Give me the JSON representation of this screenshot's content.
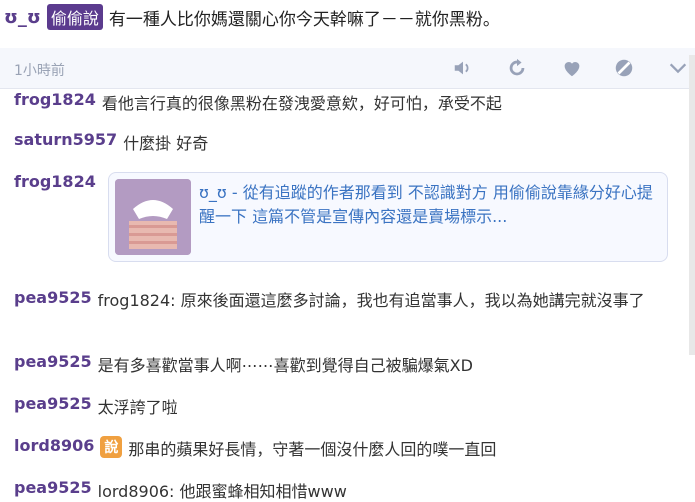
{
  "post": {
    "author": "ʊ_ʊ",
    "board": "偷偷說",
    "text": "有一種人比你媽還關心你今天幹嘛了－－就你黑粉。"
  },
  "meta": {
    "time": "1小時前",
    "icons": [
      "speaker-icon",
      "refresh-icon",
      "heart-icon",
      "block-icon",
      "chevron-down-icon"
    ]
  },
  "comments": [
    {
      "user": "frog1824",
      "text": "看他言行真的很像黑粉在發洩愛意欸，好可怕，承受不起"
    },
    {
      "user": "saturn5957",
      "text": "什麼掛 好奇"
    },
    {
      "user": "frog1824",
      "text": ""
    },
    {
      "user": "pea9525",
      "text": "frog1824: 原來後面還這麼多討論，我也有追當事人，我以為她講完就沒事了"
    },
    {
      "user": "pea9525",
      "text": "是有多喜歡當事人啊⋯⋯喜歡到覺得自己被騙爆氣XD"
    },
    {
      "user": "pea9525",
      "text": "太浮誇了啦"
    },
    {
      "user": "lord8906",
      "badge": "說",
      "text": "那串的蘋果好長情，守著一個沒什麼人回的噗一直回"
    },
    {
      "user": "pea9525",
      "text": "lord8906: 他跟蜜蜂相知相惜www"
    }
  ],
  "preview": {
    "text": "ʊ_ʊ - 從有追蹤的作者那看到 不認識對方 用偷偷說靠緣分好心提醒一下 這篇不管是宣傳內容還是賣場標示..."
  },
  "colors": {
    "accent": "#5b3b8e",
    "username": "#5a3e8c",
    "link": "#3a73c2",
    "meta_bg": "#f5f7fc"
  }
}
